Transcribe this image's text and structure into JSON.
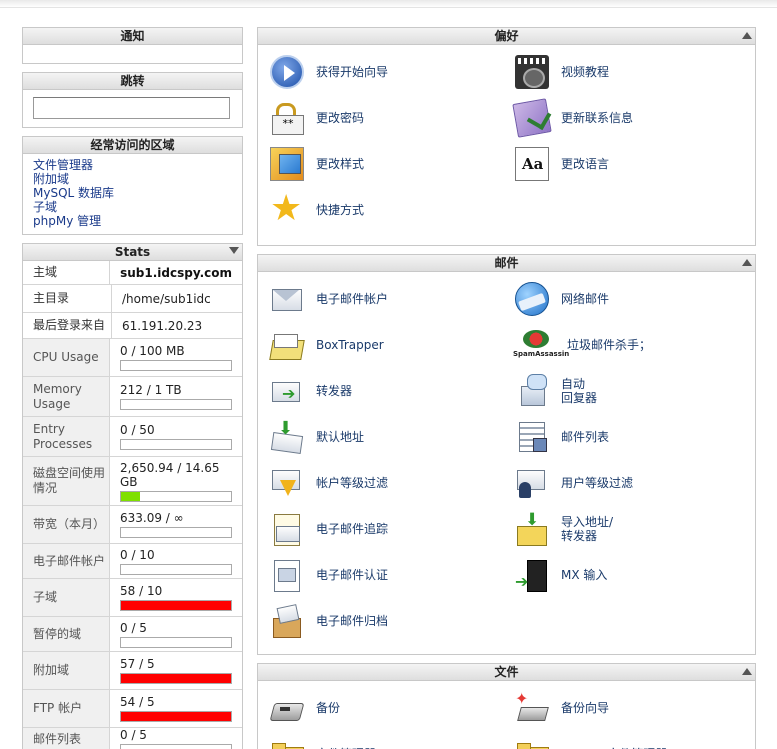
{
  "left": {
    "notice_title": "通知",
    "jump_title": "跳转",
    "jump_input_value": "",
    "fav_title": "经常访问的区域",
    "fav_links": [
      "文件管理器",
      "附加域",
      "MySQL 数据库",
      "子域",
      "phpMy 管理"
    ],
    "stats_title": "Stats",
    "stats": [
      {
        "label": "主域",
        "value": "sub1.idcspy.com",
        "bold": true
      },
      {
        "label": "主目录",
        "value": "/home/sub1idc"
      },
      {
        "label": "最后登录来自",
        "value": "61.191.20.23"
      },
      {
        "label": "CPU Usage",
        "value": "0 / 100 MB",
        "percent": 0
      },
      {
        "label": "Memory Usage",
        "value": "212 / 1 TB",
        "percent": 0
      },
      {
        "label": "Entry Processes",
        "value": "0 / 50",
        "percent": 0
      },
      {
        "label": "磁盘空间使用情况",
        "value": "2,650.94 / 14.65 GB",
        "percent": 17.7,
        "bar_color": "#7fe000"
      },
      {
        "label": "带宽（本月）",
        "value": "633.09 / ∞",
        "percent": 0
      },
      {
        "label": "电子邮件帐户",
        "value": "0 / 10",
        "percent": 0
      },
      {
        "label": "子域",
        "value": "58 / 10",
        "percent": 100,
        "bar_color": "#ff0000"
      },
      {
        "label": "暂停的域",
        "value": "0 / 5",
        "percent": 0
      },
      {
        "label": "附加域",
        "value": "57 / 5",
        "percent": 100,
        "bar_color": "#ff0000"
      },
      {
        "label": "FTP 帐户",
        "value": "54 / 5",
        "percent": 100,
        "bar_color": "#ff0000"
      },
      {
        "label": "邮件列表",
        "value": "0 / 5",
        "percent": 0
      }
    ]
  },
  "sections": {
    "prefs_title": "偏好",
    "prefs": [
      {
        "label": "获得开始向导",
        "icon": "start-wizard-icon"
      },
      {
        "label": "视频教程",
        "icon": "video-tutorials-icon"
      },
      {
        "label": "更改密码",
        "icon": "change-password-icon"
      },
      {
        "label": "更新联系信息",
        "icon": "contact-info-icon"
      },
      {
        "label": "更改样式",
        "icon": "change-style-icon"
      },
      {
        "label": "更改语言",
        "icon": "change-language-icon"
      },
      {
        "label": "快捷方式",
        "icon": "shortcuts-icon"
      }
    ],
    "mail_title": "邮件",
    "mail": [
      {
        "label": "电子邮件帐户",
        "icon": "email-accounts-icon"
      },
      {
        "label": "网络邮件",
        "icon": "webmail-icon"
      },
      {
        "label": "BoxTrapper",
        "icon": "boxtrapper-icon"
      },
      {
        "label": "垃圾邮件杀手；",
        "icon": "spamassassin-icon"
      },
      {
        "label": "转发器",
        "icon": "forwarders-icon"
      },
      {
        "label": "自动\n回复器",
        "icon": "autoresponders-icon"
      },
      {
        "label": "默认地址",
        "icon": "default-address-icon"
      },
      {
        "label": "邮件列表",
        "icon": "mailing-lists-icon"
      },
      {
        "label": "帐户等级过滤",
        "icon": "account-filter-icon"
      },
      {
        "label": "用户等级过滤",
        "icon": "user-filter-icon"
      },
      {
        "label": "电子邮件追踪",
        "icon": "email-trace-icon"
      },
      {
        "label": "导入地址/\n转发器",
        "icon": "import-addresses-icon"
      },
      {
        "label": "电子邮件认证",
        "icon": "email-auth-icon"
      },
      {
        "label": "MX 输入",
        "icon": "mx-entry-icon"
      },
      {
        "label": "电子邮件归档",
        "icon": "email-archive-icon"
      }
    ],
    "files_title": "文件",
    "files": [
      {
        "label": "备份",
        "icon": "backup-icon"
      },
      {
        "label": "备份向导",
        "icon": "backup-wizard-icon"
      },
      {
        "label": "文件管理器",
        "icon": "file-manager-icon"
      },
      {
        "label": "Legacy 文件管理器",
        "icon": "legacy-file-manager-icon"
      }
    ]
  }
}
